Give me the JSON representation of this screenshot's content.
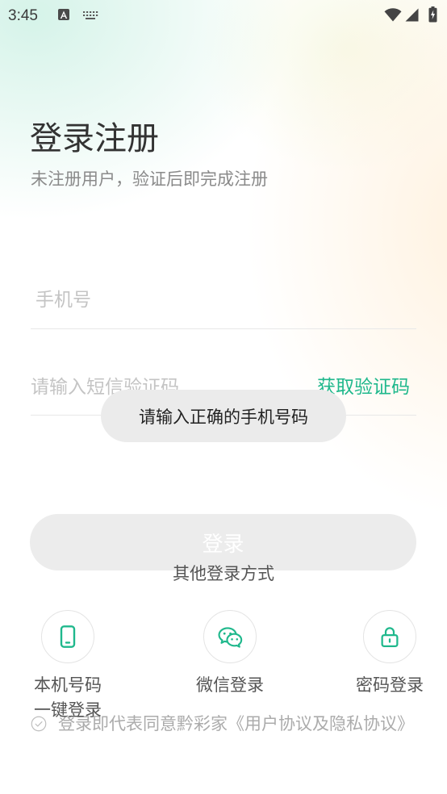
{
  "status_bar": {
    "time": "3:45"
  },
  "header": {
    "title": "登录注册",
    "subtitle": "未注册用户，验证后即完成注册"
  },
  "form": {
    "phone": {
      "value": "",
      "placeholder": "手机号"
    },
    "code": {
      "value": "",
      "placeholder": "请输入短信验证码"
    },
    "get_code_label": "获取验证码",
    "login_label": "登录"
  },
  "toast": {
    "message": "请输入正确的手机号码"
  },
  "other_login": {
    "title": "其他登录方式",
    "options": [
      {
        "label": "本机号码一键登录",
        "icon": "phone-icon"
      },
      {
        "label": "微信登录",
        "icon": "wechat-icon"
      },
      {
        "label": "密码登录",
        "icon": "lock-icon"
      }
    ]
  },
  "agreement": {
    "checked": false,
    "text": "登录即代表同意黔彩家《用户协议及隐私协议》"
  },
  "theme": {
    "accent": "#1fb88c",
    "button_disabled": "#ececec",
    "toast_bg": "#ebebeb"
  }
}
